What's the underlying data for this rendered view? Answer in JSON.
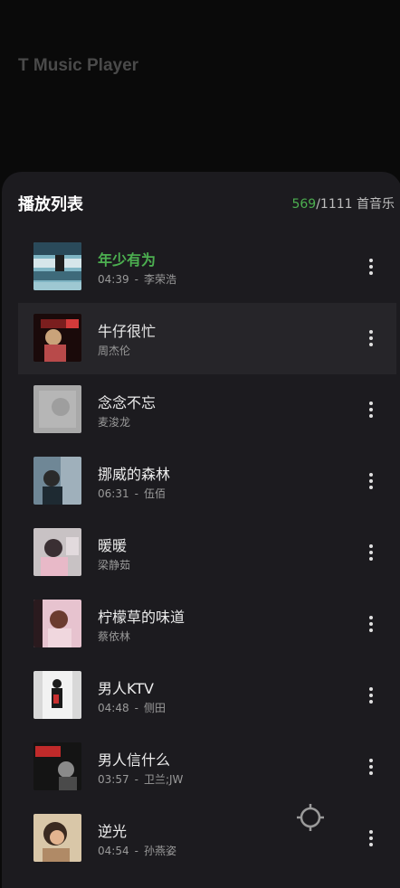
{
  "app": {
    "title": "T Music Player"
  },
  "playlist": {
    "title": "播放列表",
    "count_current": "569",
    "count_separator": "/",
    "count_total": "1111",
    "count_unit": "首音乐"
  },
  "songs": [
    {
      "title": "年少有为",
      "duration": "04:39",
      "sep": "-",
      "artist": "李荣浩",
      "playing": true,
      "cover_icon": "album-cover-nianshaoyouwei"
    },
    {
      "title": "牛仔很忙",
      "duration": "",
      "sep": "",
      "artist": "周杰伦",
      "playing": false,
      "cover_icon": "album-cover-niuzaihenmang"
    },
    {
      "title": "念念不忘",
      "duration": "",
      "sep": "",
      "artist": "麦浚龙",
      "playing": false,
      "cover_icon": "album-cover-niannianbuwang"
    },
    {
      "title": "挪威的森林",
      "duration": "06:31",
      "sep": "-",
      "artist": "伍佰",
      "playing": false,
      "cover_icon": "album-cover-nuoweidesenlin"
    },
    {
      "title": "暖暖",
      "duration": "",
      "sep": "",
      "artist": "梁静茹",
      "playing": false,
      "cover_icon": "album-cover-nuannuan"
    },
    {
      "title": "柠檬草的味道",
      "duration": "",
      "sep": "",
      "artist": "蔡依林",
      "playing": false,
      "cover_icon": "album-cover-ningmengcao"
    },
    {
      "title": "男人KTV",
      "duration": "04:48",
      "sep": "-",
      "artist": "侧田",
      "playing": false,
      "cover_icon": "album-cover-nanrenktv"
    },
    {
      "title": "男人信什么",
      "duration": "03:57",
      "sep": "-",
      "artist": "卫兰;JW",
      "playing": false,
      "cover_icon": "album-cover-nanrenxinshenme"
    },
    {
      "title": "逆光",
      "duration": "04:54",
      "sep": "-",
      "artist": "孙燕姿",
      "playing": false,
      "cover_icon": "album-cover-niguang"
    }
  ],
  "colors": {
    "accent": "#4caf50",
    "sheet_bg": "#1c1b1f",
    "highlight_row_bg": "#262529",
    "page_bg": "#0a0a0a"
  },
  "icons": {
    "more": "more-vert-icon",
    "locate": "locate-crosshair-icon"
  }
}
